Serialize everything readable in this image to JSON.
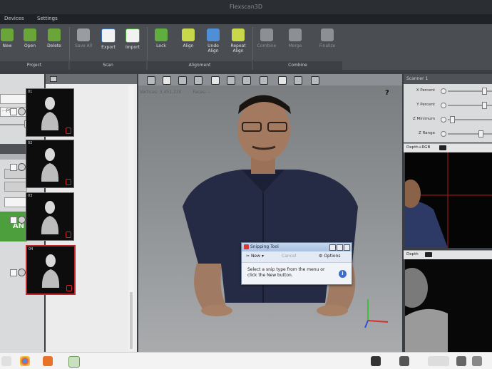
{
  "window": {
    "title": "Flexscan3D"
  },
  "menu": {
    "items": [
      "Devices",
      "Settings"
    ]
  },
  "ribbon": {
    "groups": [
      {
        "label": "Project",
        "buttons": [
          {
            "label": "New"
          },
          {
            "label": "Open"
          },
          {
            "label": "Delete"
          }
        ]
      },
      {
        "label": "Scan",
        "buttons": [
          {
            "label": "Save All"
          },
          {
            "label": "Export"
          },
          {
            "label": "Import"
          }
        ]
      },
      {
        "label": "Alignment",
        "buttons": [
          {
            "label": "Lock"
          },
          {
            "label": "Align"
          },
          {
            "label": "Undo Align"
          },
          {
            "label": "Repeat Align"
          }
        ]
      },
      {
        "label": "Combine",
        "buttons": [
          {
            "label": "Combine"
          },
          {
            "label": "Merge"
          },
          {
            "label": "Finalize"
          }
        ]
      }
    ]
  },
  "left_panel": {
    "dropdown_2_value": "...py",
    "scan_button": "AN"
  },
  "thumbnails": {
    "items": [
      {
        "num": "01",
        "selected": false
      },
      {
        "num": "02",
        "selected": false
      },
      {
        "num": "03",
        "selected": false
      },
      {
        "num": "04",
        "selected": true
      }
    ]
  },
  "viewport": {
    "info_a": "Vertices: 3,451,230",
    "info_b": "Faces: --",
    "help": "?"
  },
  "snipping_tool": {
    "title": "Snipping Tool",
    "new_label": "New",
    "cancel_label": "Cancel",
    "options_label": "Options",
    "message": "Select a snip type from the menu or click the New button.",
    "info_icon": "i"
  },
  "right_panel": {
    "title": "Scanner 1",
    "sliders": [
      {
        "label": "X Percent",
        "value": 0.85
      },
      {
        "label": "Y Percent",
        "value": 0.85
      },
      {
        "label": "Z Minimum",
        "value": 0.05
      },
      {
        "label": "Z Range",
        "value": 0.75
      }
    ],
    "rgb_label": "Depth+RGB",
    "depth_label": "Depth"
  },
  "colors": {
    "accent_green": "#4d9e3c",
    "lock_red": "#c2272d"
  }
}
